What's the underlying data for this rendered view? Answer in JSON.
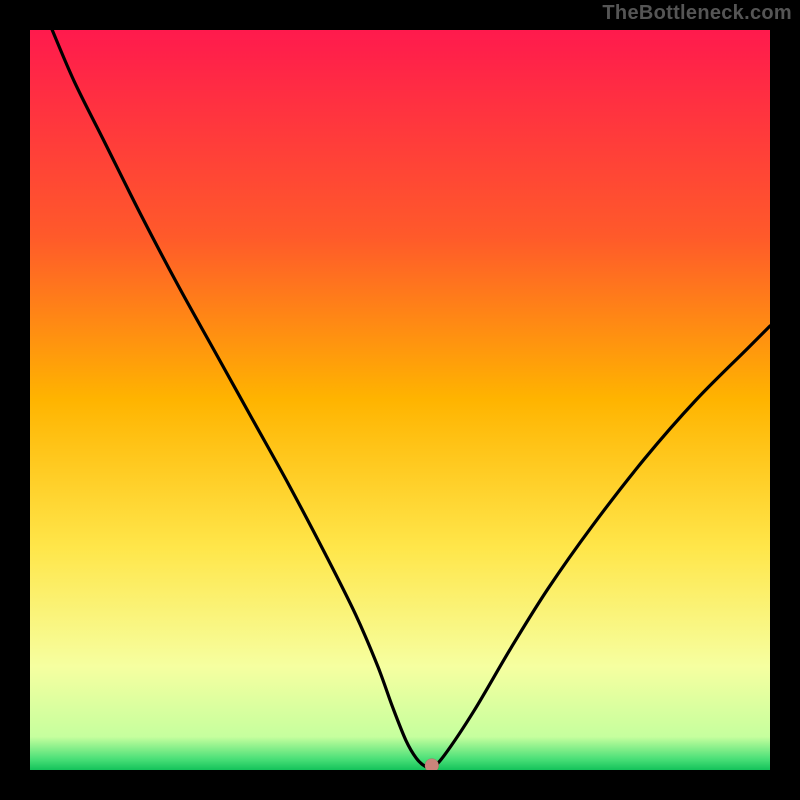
{
  "watermark": "TheBottleneck.com",
  "chart_data": {
    "type": "line",
    "title": "",
    "xlabel": "",
    "ylabel": "",
    "xlim": [
      0,
      100
    ],
    "ylim": [
      0,
      100
    ],
    "background_gradient": {
      "stops": [
        {
          "offset": 0,
          "color": "#ff1a4d"
        },
        {
          "offset": 0.28,
          "color": "#ff5a2a"
        },
        {
          "offset": 0.5,
          "color": "#ffb400"
        },
        {
          "offset": 0.7,
          "color": "#ffe64a"
        },
        {
          "offset": 0.86,
          "color": "#f6ffa0"
        },
        {
          "offset": 0.955,
          "color": "#c6ff9e"
        },
        {
          "offset": 0.985,
          "color": "#4be078"
        },
        {
          "offset": 1.0,
          "color": "#14c25a"
        }
      ]
    },
    "series": [
      {
        "name": "bottleneck-curve",
        "x": [
          3,
          6,
          10,
          15,
          20,
          25,
          30,
          35,
          40,
          44,
          47,
          49,
          50.8,
          52.2,
          53.4,
          54.4,
          56,
          60,
          65,
          70,
          76,
          83,
          90,
          97,
          100
        ],
        "y": [
          100,
          93,
          85,
          75,
          65.5,
          56.5,
          47.5,
          38.5,
          29,
          21,
          14,
          8.5,
          4,
          1.6,
          0.5,
          0.4,
          2,
          8,
          16.5,
          24.5,
          33,
          42,
          50,
          57,
          60
        ]
      }
    ],
    "marker": {
      "x": 54.3,
      "y": 0.6,
      "color": "#c9857b",
      "radius": 7
    }
  }
}
